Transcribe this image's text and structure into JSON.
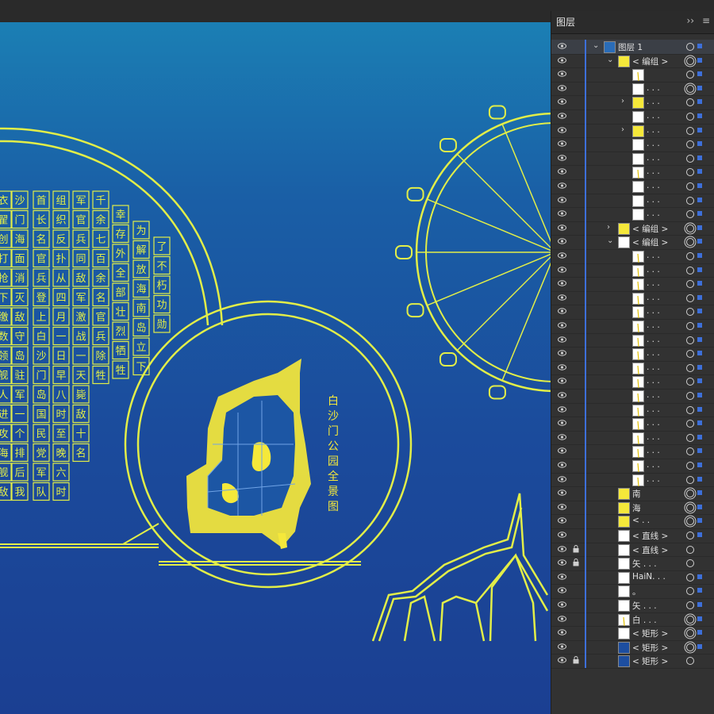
{
  "panel": {
    "tab_label": "图层",
    "collapse_icon": "double-chevron-right-icon",
    "menu_icon": "hamburger-menu-icon"
  },
  "colors": {
    "canvas_top": "#1b7fb4",
    "canvas_bottom": "#1b3f92",
    "line_yellow": "#e2ee48",
    "fill_yellow": "#f5e83a",
    "selection_blue": "#3d6fd9",
    "panel_bg": "#323232"
  },
  "artwork": {
    "map_title": [
      "白",
      "沙",
      "门",
      "公",
      "园",
      "全",
      "景",
      "图"
    ],
    "poem_columns": [
      [
        "衣",
        "翟",
        "创",
        "打",
        "抢",
        "下",
        "缴",
        "数",
        "领",
        "舰",
        "人",
        "进",
        "攻",
        "海",
        "舰",
        "敌"
      ],
      [
        "沙",
        "门",
        "海",
        "面",
        "消",
        "灭",
        "敌",
        "守",
        "岛",
        "驻",
        "军",
        "一",
        "个",
        "排",
        "后",
        "我"
      ],
      [
        "首",
        "长",
        "名",
        "官",
        "兵",
        "登",
        "上",
        "白",
        "沙",
        "门",
        "岛",
        "国",
        "民",
        "党",
        "军",
        "队"
      ],
      [
        "组",
        "织",
        "反",
        "扑",
        "从",
        "四",
        "月",
        "一",
        "日",
        "早",
        "八",
        "时",
        "至",
        "晚",
        "六",
        "时"
      ],
      [
        "军",
        "官",
        "兵",
        "同",
        "敌",
        "军",
        "激",
        "战",
        "一",
        "天",
        "毙",
        "敌",
        "十",
        "名"
      ],
      [
        "千",
        "余",
        "七",
        "百",
        "余",
        "名",
        "官",
        "兵",
        "除",
        "牲"
      ],
      [
        "幸",
        "存",
        "外",
        "全",
        "部",
        "壮",
        "烈",
        "牺",
        "牲"
      ],
      [
        "为",
        "解",
        "放",
        "海",
        "南",
        "岛",
        "立",
        "下"
      ],
      [
        "了",
        "不",
        "朽",
        "功",
        "勋"
      ]
    ]
  },
  "layers": [
    {
      "label": "图层 1",
      "depth": 0,
      "twisty": "v",
      "thumb": "map",
      "target": "single",
      "sq": true,
      "selected": true
    },
    {
      "label": "< 编组 >",
      "depth": 1,
      "twisty": "v",
      "thumb": "y",
      "target": "double",
      "sq": true
    },
    {
      "label": "",
      "depth": 2,
      "twisty": "",
      "thumb": "line",
      "target": "single",
      "sq": true
    },
    {
      "label": ". . .",
      "depth": 2,
      "twisty": "",
      "thumb": "w",
      "target": "double",
      "sq": true
    },
    {
      "label": ". . .",
      "depth": 2,
      "twisty": ">",
      "thumb": "y",
      "target": "single",
      "sq": true
    },
    {
      "label": ". . .",
      "depth": 2,
      "twisty": "",
      "thumb": "w",
      "target": "single",
      "sq": true
    },
    {
      "label": ". . .",
      "depth": 2,
      "twisty": ">",
      "thumb": "y",
      "target": "single",
      "sq": true
    },
    {
      "label": ". . .",
      "depth": 2,
      "twisty": "",
      "thumb": "w",
      "target": "single",
      "sq": true
    },
    {
      "label": ". . .",
      "depth": 2,
      "twisty": "",
      "thumb": "w",
      "target": "single",
      "sq": true
    },
    {
      "label": ". . .",
      "depth": 2,
      "twisty": "",
      "thumb": "line",
      "target": "single",
      "sq": true
    },
    {
      "label": ". . .",
      "depth": 2,
      "twisty": "",
      "thumb": "w",
      "target": "single",
      "sq": true
    },
    {
      "label": ". . .",
      "depth": 2,
      "twisty": "",
      "thumb": "w",
      "target": "single",
      "sq": true
    },
    {
      "label": ". . .",
      "depth": 2,
      "twisty": "",
      "thumb": "w",
      "target": "single",
      "sq": true
    },
    {
      "label": "< 编组 >",
      "depth": 1,
      "twisty": ">",
      "thumb": "y",
      "target": "double",
      "sq": true
    },
    {
      "label": "< 编组 >",
      "depth": 1,
      "twisty": "v",
      "thumb": "w",
      "target": "double",
      "sq": true
    },
    {
      "label": ". . .",
      "depth": 2,
      "twisty": "",
      "thumb": "line",
      "target": "single",
      "sq": true
    },
    {
      "label": ". . .",
      "depth": 2,
      "twisty": "",
      "thumb": "line",
      "target": "single",
      "sq": true
    },
    {
      "label": ". . .",
      "depth": 2,
      "twisty": "",
      "thumb": "line",
      "target": "single",
      "sq": true
    },
    {
      "label": ". . .",
      "depth": 2,
      "twisty": "",
      "thumb": "line",
      "target": "single",
      "sq": true
    },
    {
      "label": ". . .",
      "depth": 2,
      "twisty": "",
      "thumb": "line",
      "target": "single",
      "sq": true
    },
    {
      "label": ". . .",
      "depth": 2,
      "twisty": "",
      "thumb": "line",
      "target": "single",
      "sq": true
    },
    {
      "label": ". . .",
      "depth": 2,
      "twisty": "",
      "thumb": "line",
      "target": "single",
      "sq": true
    },
    {
      "label": ". . .",
      "depth": 2,
      "twisty": "",
      "thumb": "line",
      "target": "single",
      "sq": true
    },
    {
      "label": ". . .",
      "depth": 2,
      "twisty": "",
      "thumb": "line",
      "target": "single",
      "sq": true
    },
    {
      "label": ". . .",
      "depth": 2,
      "twisty": "",
      "thumb": "line",
      "target": "single",
      "sq": true
    },
    {
      "label": ". . .",
      "depth": 2,
      "twisty": "",
      "thumb": "line",
      "target": "single",
      "sq": true
    },
    {
      "label": ". . .",
      "depth": 2,
      "twisty": "",
      "thumb": "line",
      "target": "single",
      "sq": true
    },
    {
      "label": ". . .",
      "depth": 2,
      "twisty": "",
      "thumb": "line",
      "target": "single",
      "sq": true
    },
    {
      "label": ". . .",
      "depth": 2,
      "twisty": "",
      "thumb": "line",
      "target": "single",
      "sq": true
    },
    {
      "label": ". . .",
      "depth": 2,
      "twisty": "",
      "thumb": "line",
      "target": "single",
      "sq": true
    },
    {
      "label": ". . .",
      "depth": 2,
      "twisty": "",
      "thumb": "line",
      "target": "single",
      "sq": true
    },
    {
      "label": ". . .",
      "depth": 2,
      "twisty": "",
      "thumb": "line",
      "target": "single",
      "sq": true
    },
    {
      "label": "南",
      "depth": 1,
      "twisty": "",
      "thumb": "y",
      "target": "double",
      "sq": true
    },
    {
      "label": "海",
      "depth": 1,
      "twisty": "",
      "thumb": "y",
      "target": "double",
      "sq": true
    },
    {
      "label": "< . .",
      "depth": 1,
      "twisty": "",
      "thumb": "y",
      "target": "double",
      "sq": true
    },
    {
      "label": "< 直线 >",
      "depth": 1,
      "twisty": "",
      "thumb": "w",
      "target": "single",
      "sq": true
    },
    {
      "label": "< 直线 >",
      "depth": 1,
      "twisty": "",
      "thumb": "w",
      "target": "single",
      "sq": false,
      "locked": true
    },
    {
      "label": "矢 . . .",
      "depth": 1,
      "twisty": "",
      "thumb": "w",
      "target": "single",
      "sq": false,
      "locked": true
    },
    {
      "label": "HaiN. . .",
      "depth": 1,
      "twisty": "",
      "thumb": "w",
      "target": "single",
      "sq": true
    },
    {
      "label": "。",
      "depth": 1,
      "twisty": "",
      "thumb": "w",
      "target": "single",
      "sq": true
    },
    {
      "label": "矢 . . .",
      "depth": 1,
      "twisty": "",
      "thumb": "w",
      "target": "single",
      "sq": true
    },
    {
      "label": "白 . . .",
      "depth": 1,
      "twisty": "",
      "thumb": "line",
      "target": "double",
      "sq": true
    },
    {
      "label": "< 矩形 >",
      "depth": 1,
      "twisty": "",
      "thumb": "w",
      "target": "double",
      "sq": true
    },
    {
      "label": "< 矩形 >",
      "depth": 1,
      "twisty": "",
      "thumb": "n",
      "target": "double",
      "sq": true
    },
    {
      "label": "< 矩形 >",
      "depth": 1,
      "twisty": "",
      "thumb": "n",
      "target": "single",
      "sq": false,
      "locked": true
    }
  ]
}
